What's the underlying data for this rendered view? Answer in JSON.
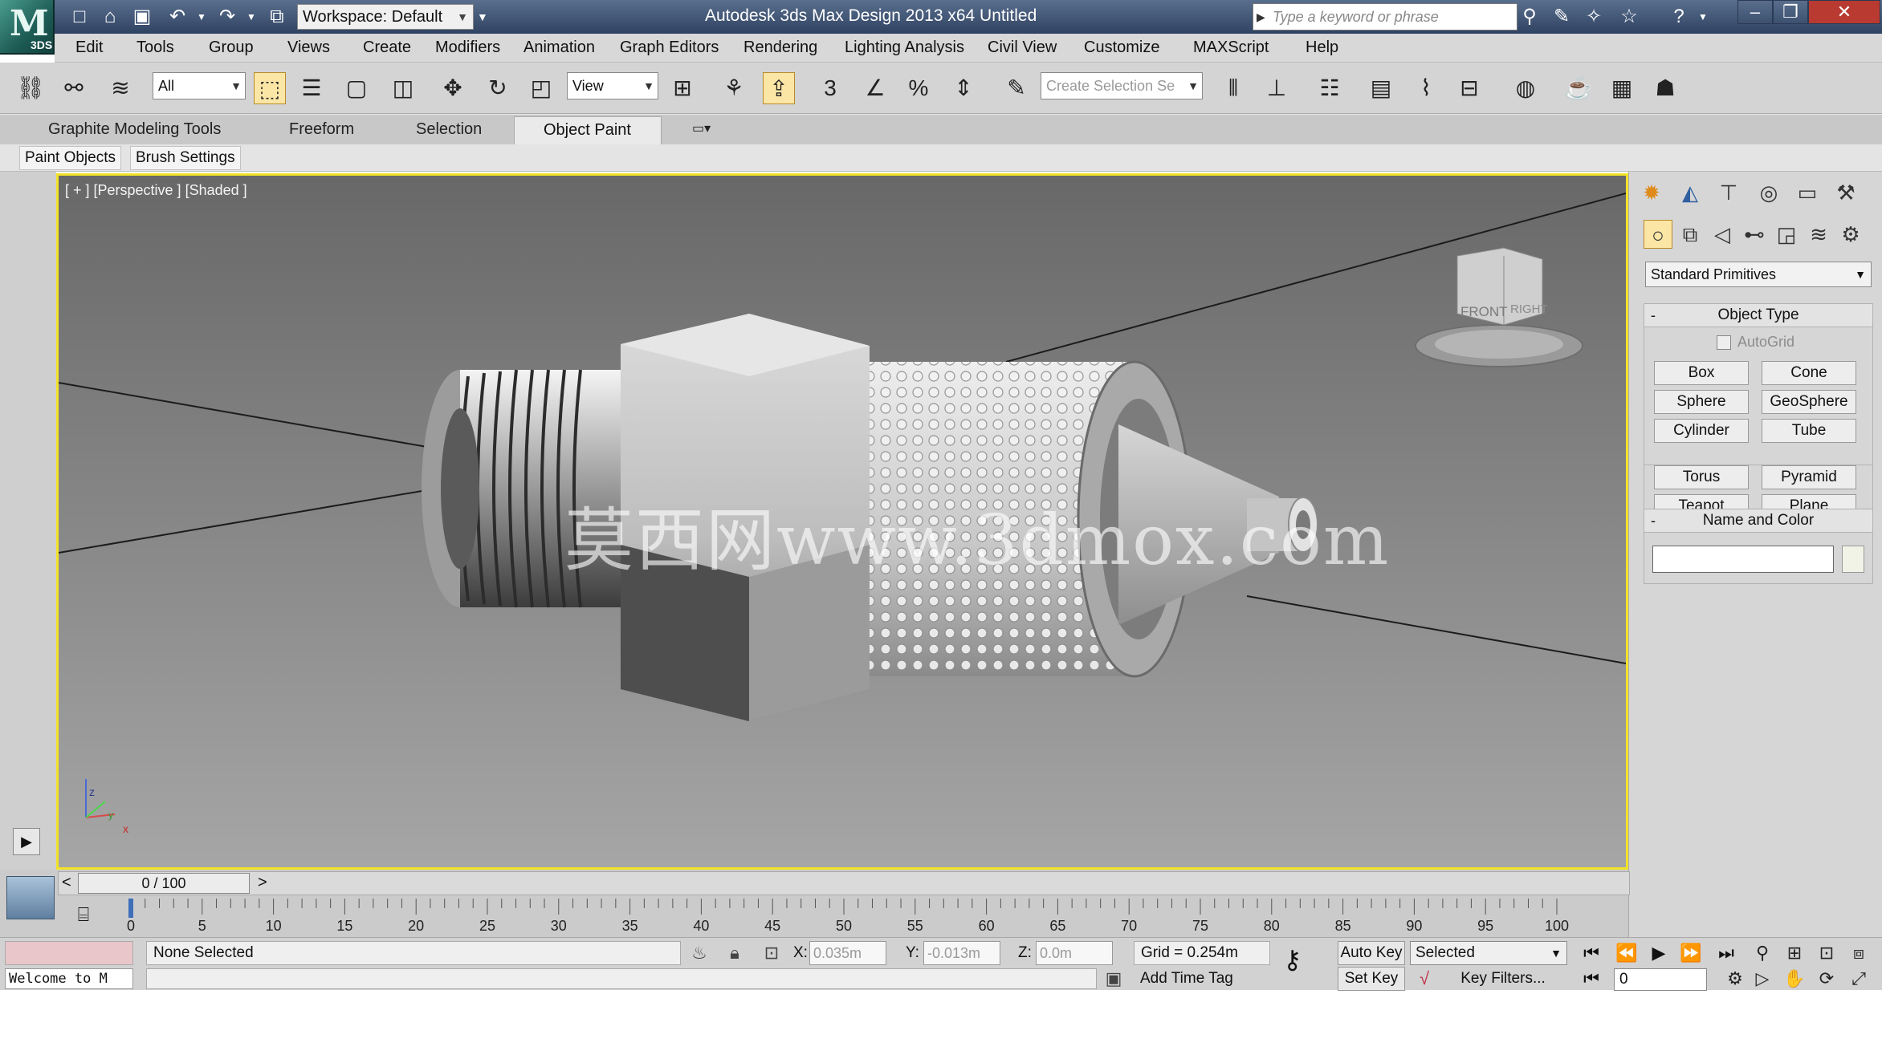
{
  "titlebar": {
    "app_version": "3DS",
    "workspace": "Workspace: Default",
    "title": "Autodesk 3ds Max Design 2013 x64      Untitled",
    "search_placeholder": "Type a keyword or phrase"
  },
  "menus": [
    "Edit",
    "Tools",
    "Group",
    "Views",
    "Create",
    "Modifiers",
    "Animation",
    "Graph Editors",
    "Rendering",
    "Lighting Analysis",
    "Civil View",
    "Customize",
    "MAXScript",
    "Help"
  ],
  "toolbar": {
    "selection_filter": "All",
    "reference_coord": "View",
    "named_selection_placeholder": "Create Selection Se",
    "snap_label": "3"
  },
  "ribbon": {
    "tabs": [
      "Graphite Modeling Tools",
      "Freeform",
      "Selection",
      "Object Paint"
    ],
    "active_tab": "Object Paint",
    "subtabs": [
      "Paint Objects",
      "Brush Settings"
    ]
  },
  "viewport": {
    "label": "[ + ] [Perspective ] [Shaded ]",
    "watermark": "莫西网www.3dmox.com",
    "viewcube_front": "FRONT",
    "viewcube_right": "RIGHT",
    "axis_z": "z",
    "axis_x": "x",
    "axis_y": "y"
  },
  "command_panel": {
    "category": "Standard Primitives",
    "object_type_title": "Object Type",
    "autogrid_label": "AutoGrid",
    "primitives": [
      "Box",
      "Cone",
      "Sphere",
      "GeoSphere",
      "Cylinder",
      "Tube",
      "Torus",
      "Pyramid",
      "Teapot",
      "Plane"
    ],
    "name_color_title": "Name and Color",
    "object_color": "#f0f3e6"
  },
  "timeline": {
    "current": "0 / 100",
    "ticks": [
      "0",
      "5",
      "10",
      "15",
      "20",
      "25",
      "30",
      "35",
      "40",
      "45",
      "50",
      "55",
      "60",
      "65",
      "70",
      "75",
      "80",
      "85",
      "90",
      "95",
      "100"
    ]
  },
  "status": {
    "listener_text": "Welcome to M",
    "selection": "None Selected",
    "x_label": "X:",
    "x_value": "0.035m",
    "y_label": "Y:",
    "y_value": "-0.013m",
    "z_label": "Z:",
    "z_value": "0.0m",
    "grid": "Grid = 0.254m",
    "add_time_tag": "Add Time Tag",
    "auto_key": "Auto Key",
    "set_key": "Set Key",
    "selected_mode": "Selected",
    "key_filters": "Key Filters...",
    "frame": "0"
  }
}
